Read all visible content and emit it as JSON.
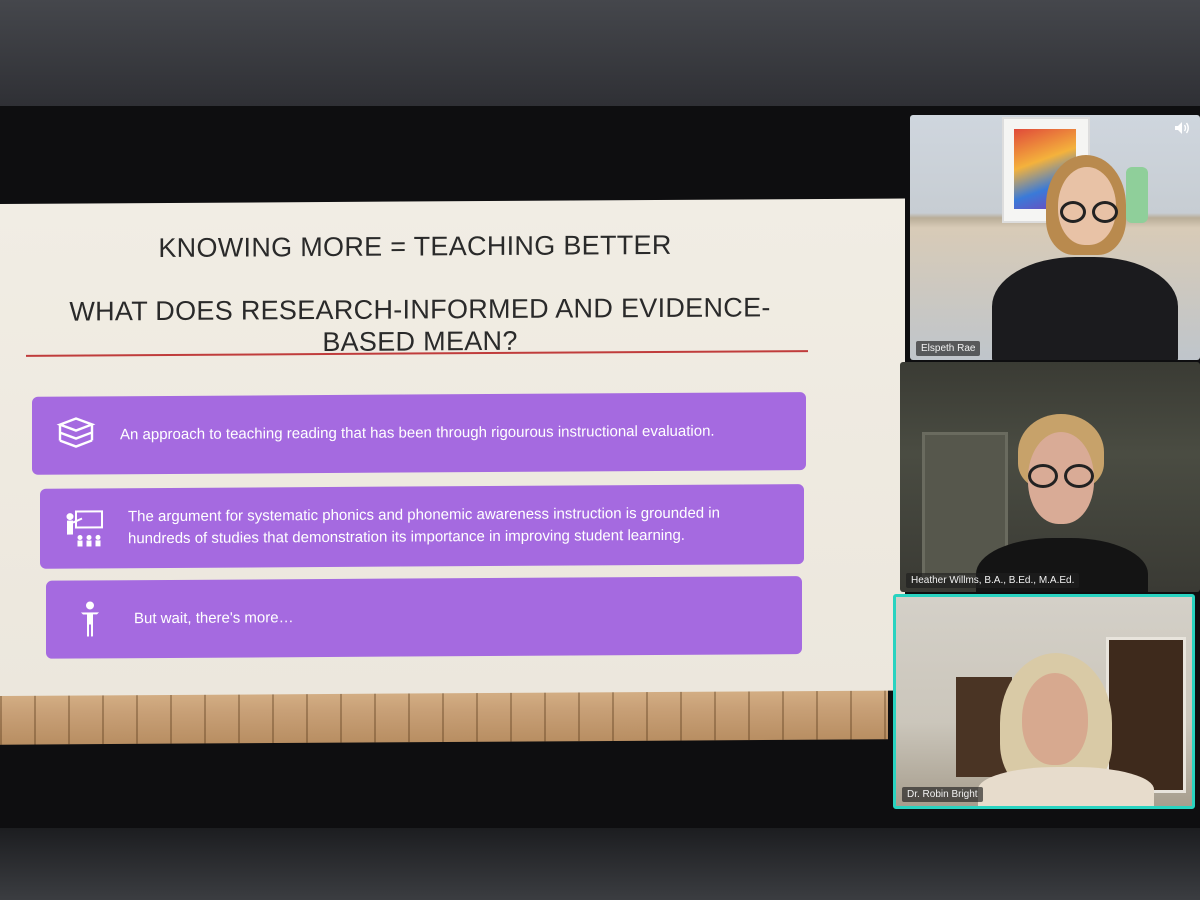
{
  "slide": {
    "title": "KNOWING MORE = TEACHING BETTER",
    "subtitle": "WHAT DOES RESEARCH-INFORMED AND EVIDENCE-BASED MEAN?",
    "points": [
      {
        "icon": "books-stack-icon",
        "text": "An approach to teaching reading that has been through rigourous instructional evaluation."
      },
      {
        "icon": "teacher-classroom-icon",
        "text": "The argument for systematic phonics and phonemic awareness instruction is grounded in hundreds of studies that demonstration its importance in improving student learning."
      },
      {
        "icon": "standing-person-icon",
        "text": "But wait, there's more…"
      }
    ],
    "colors": {
      "card": "#a56ae0",
      "rule": "#c03c3c",
      "background": "#f1ede4"
    }
  },
  "participants": [
    {
      "name": "Elspeth Rae",
      "speaker_icon": "speaker-volume-icon"
    },
    {
      "name": "Heather Willms, B.A., B.Ed., M.A.Ed."
    },
    {
      "name": "Dr. Robin Bright",
      "active_speaker": true,
      "highlight": "#29d3c0"
    }
  ]
}
